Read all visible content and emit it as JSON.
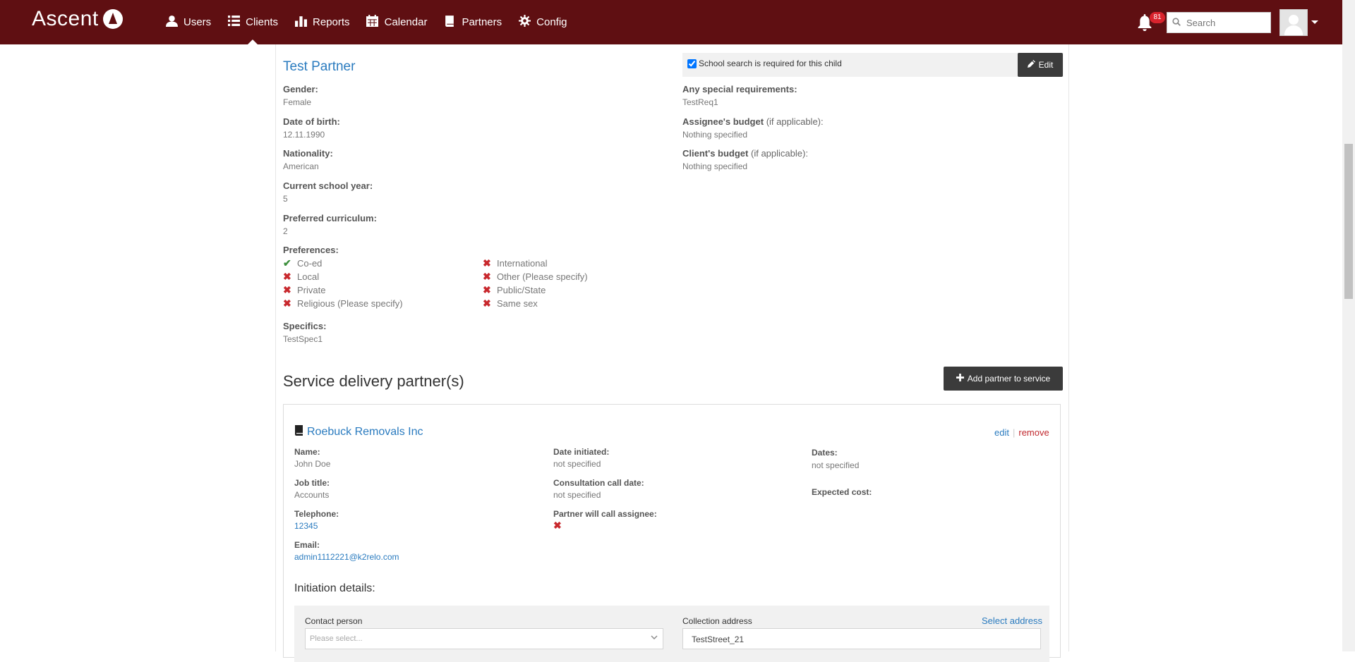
{
  "nav": {
    "brand": "Ascent",
    "items": [
      {
        "label": "Users",
        "icon": "user-icon"
      },
      {
        "label": "Clients",
        "icon": "list-icon"
      },
      {
        "label": "Reports",
        "icon": "bar-chart-icon"
      },
      {
        "label": "Calendar",
        "icon": "calendar-icon"
      },
      {
        "label": "Partners",
        "icon": "book-icon"
      },
      {
        "label": "Config",
        "icon": "gear-icon"
      }
    ],
    "active": "Clients",
    "notifications_count": "81",
    "search_placeholder": "Search"
  },
  "child": {
    "name": "Test Partner",
    "school_search_label": "School search is required for this child",
    "school_search_checked": true,
    "edit_label": "Edit",
    "gender_label": "Gender:",
    "gender": "Female",
    "dob_label": "Date of birth:",
    "dob": "12.11.1990",
    "nationality_label": "Nationality:",
    "nationality": "American",
    "school_year_label": "Current school year:",
    "school_year": "5",
    "curriculum_label": "Preferred curriculum:",
    "curriculum": "2",
    "preferences_label": "Preferences:",
    "preferences_col1": [
      {
        "label": "Co-ed",
        "checked": true
      },
      {
        "label": "Local",
        "checked": false
      },
      {
        "label": "Private",
        "checked": false
      },
      {
        "label": "Religious (Please specify)",
        "checked": false
      }
    ],
    "preferences_col2": [
      {
        "label": "International",
        "checked": false
      },
      {
        "label": "Other (Please specify)",
        "checked": false
      },
      {
        "label": "Public/State",
        "checked": false
      },
      {
        "label": "Same sex",
        "checked": false
      }
    ],
    "specifics_label": "Specifics:",
    "specifics": "TestSpec1",
    "requirements_label": "Any special requirements:",
    "requirements": "TestReq1",
    "assignee_budget_label": "Assignee's budget",
    "assignee_budget_suffix": "(if applicable):",
    "assignee_budget": "Nothing specified",
    "client_budget_label": "Client's budget",
    "client_budget_suffix": "(if applicable):",
    "client_budget": "Nothing specified"
  },
  "service": {
    "title": "Service delivery partner(s)",
    "add_button": "Add partner to service",
    "partner": {
      "name": "Roebuck Removals Inc",
      "edit_label": "edit",
      "remove_label": "remove",
      "name_label": "Name:",
      "contact_name": "John Doe",
      "job_label": "Job title:",
      "job": "Accounts",
      "phone_label": "Telephone:",
      "phone": "12345",
      "email_label": "Email:",
      "email": "admin1112221@k2relo.com",
      "initiated_label": "Date initiated:",
      "initiated": "not specified",
      "consult_label": "Consultation call date:",
      "consult": "not specified",
      "will_call_label": "Partner will call assignee:",
      "dates_label": "Dates:",
      "dates": "not specified",
      "cost_label": "Expected cost:"
    },
    "initiation": {
      "title": "Initiation details:",
      "contact_label": "Contact person",
      "contact_placeholder": "Please select...",
      "address_label": "Collection address",
      "select_address": "Select address",
      "address_value": "TestStreet_21"
    }
  }
}
